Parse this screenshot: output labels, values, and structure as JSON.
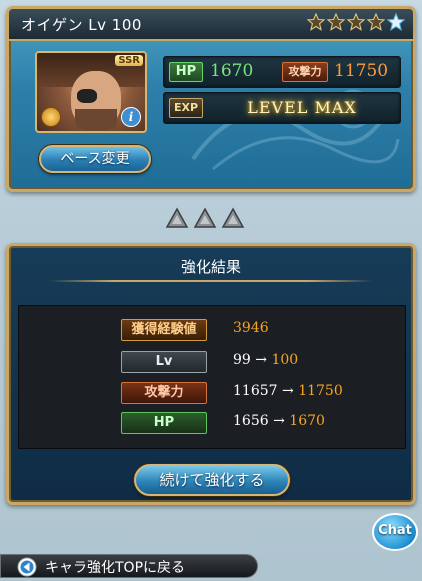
{
  "character": {
    "name": "オイゲン",
    "level_text": "Lv 100",
    "rarity_badge": "SSR",
    "stars_filled": 4,
    "stars_total": 5,
    "info_glyph": "i",
    "hp_label": "HP",
    "hp_value": "1670",
    "atk_label": "攻撃力",
    "atk_value": "11750",
    "exp_label": "EXP",
    "exp_status": "LEVEL MAX",
    "base_change_button": "ベース変更"
  },
  "result": {
    "title": "強化結果",
    "rows": [
      {
        "label": "獲得経験値",
        "value": "3946"
      },
      {
        "label": "Lv",
        "old": "99",
        "arrow": "→",
        "new": "100"
      },
      {
        "label": "攻撃力",
        "old": "11657",
        "arrow": "→",
        "new": "11750"
      },
      {
        "label": "HP",
        "old": "1656",
        "arrow": "→",
        "new": "1670"
      }
    ],
    "continue_button": "続けて強化する"
  },
  "chat": {
    "label": "Chat"
  },
  "footer": {
    "back_label": "キャラ強化TOPに戻る"
  },
  "colors": {
    "accent_gold": "#c9a867",
    "hp_green": "#7be47b",
    "atk_orange": "#ff9a3c",
    "new_value_orange": "#f5a623",
    "panel_blue": "#2d7fa9"
  },
  "icons": {
    "star": "star-icon",
    "element": "element-icon",
    "info": "info-icon",
    "triangle": "triangle-icon",
    "back": "back-arrow-icon",
    "chat": "chat-icon"
  }
}
